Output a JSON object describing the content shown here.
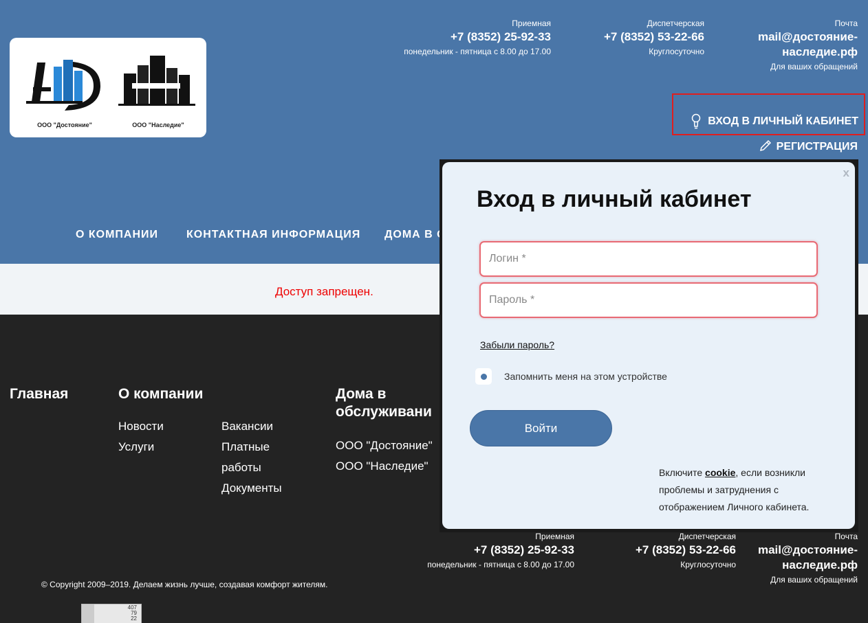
{
  "header": {
    "logo": {
      "company1": "ООО \"Достояние\"",
      "company2": "ООО \"Наследие\""
    },
    "contacts": [
      {
        "label": "Приемная",
        "value": "+7 (8352) 25-92-33",
        "sub": "понедельник - пятница с 8.00 до 17.00"
      },
      {
        "label": "Диспетчерская",
        "value": "+7 (8352) 53-22-66",
        "sub": "Круглосуточно"
      },
      {
        "label": "Почта",
        "value_line1": "mail@достояние-",
        "value_line2": "наследие.рф",
        "sub": "Для ваших обращений"
      }
    ],
    "login_link": "ВХОД В ЛИЧНЫЙ КАБИНЕТ",
    "register_link": "РЕГИСТРАЦИЯ"
  },
  "nav": {
    "items": [
      "О КОМПАНИИ",
      "КОНТАКТНАЯ ИНФОРМАЦИЯ",
      "ДОМА В О"
    ]
  },
  "content": {
    "access_denied": "Доступ запрещен."
  },
  "footer": {
    "col1_title": "Главная",
    "col2_title": "О компании",
    "col2_links": [
      "Новости",
      "Услуги"
    ],
    "col2b_links": [
      "Вакансии",
      "Платные",
      "работы",
      "Документы"
    ],
    "col3_title_line1": "Дома в",
    "col3_title_line2": "обслуживани",
    "col3_links": [
      "ООО \"Достояние\"",
      "ООО \"Наследие\""
    ],
    "contacts": [
      {
        "label": "Приемная",
        "value": "+7 (8352) 25-92-33",
        "sub": "понедельник - пятница с 8.00 до 17.00"
      },
      {
        "label": "Диспетчерская",
        "value": "+7 (8352) 53-22-66",
        "sub": "Круглосуточно"
      },
      {
        "label": "Почта",
        "value_line1": "mail@достояние-",
        "value_line2": "наследие.рф",
        "sub": "Для ваших обращений"
      }
    ],
    "copyright": "© Copyright 2009–2019. Делаем жизнь лучше, создавая комфорт жителям.",
    "counter": [
      "407",
      "79",
      "22"
    ]
  },
  "modal": {
    "close": "x",
    "title": "Вход в личный кабинет",
    "login_placeholder": "Логин *",
    "password_placeholder": "Пароль *",
    "forgot": "Забыли пароль?",
    "remember": "Запомнить меня на этом устройстве",
    "submit": "Войти",
    "cookie_pre": "Включите ",
    "cookie_link": "cookie",
    "cookie_post": ", если возникли проблемы и затруднения с отображением Личного кабинета."
  }
}
